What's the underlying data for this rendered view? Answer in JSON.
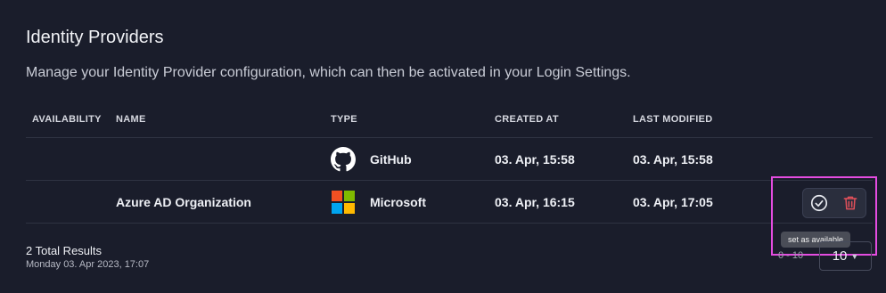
{
  "page": {
    "title": "Identity Providers",
    "description": "Manage your Identity Provider configuration, which can then be activated in your Login Settings."
  },
  "table": {
    "columns": [
      "AVAILABILITY",
      "NAME",
      "TYPE",
      "CREATED AT",
      "LAST MODIFIED"
    ],
    "rows": [
      {
        "availability": "",
        "name": "",
        "type": "GitHub",
        "type_icon": "github-icon",
        "created": "03. Apr, 15:58",
        "modified": "03. Apr, 15:58"
      },
      {
        "availability": "",
        "name": "Azure AD Organization",
        "type": "Microsoft",
        "type_icon": "microsoft-icon",
        "created": "03. Apr, 16:15",
        "modified": "03. Apr, 17:05"
      }
    ]
  },
  "actions": {
    "activate_icon": "check-circle-icon",
    "delete_icon": "trash-icon",
    "tooltip": "set as available"
  },
  "footer": {
    "total": "2 Total Results",
    "timestamp": "Monday 03. Apr 2023, 17:07",
    "range": "0 - 10",
    "page_size": "10"
  },
  "colors": {
    "background": "#1a1d2b",
    "highlight": "#e44ce0",
    "delete": "#e0505a",
    "microsoft": [
      "#f25022",
      "#7fba00",
      "#00a4ef",
      "#ffb900"
    ]
  }
}
